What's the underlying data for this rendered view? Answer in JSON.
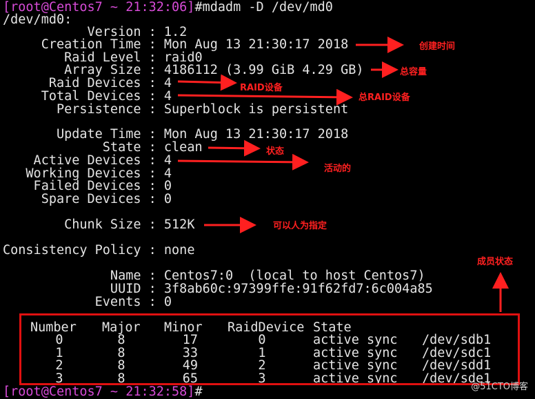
{
  "prompt_top": {
    "user": "[root@Centos7 ~ 21:32:06]",
    "cmd": "#mdadm -D /dev/md0"
  },
  "device": "/dev/md0:",
  "details": [
    {
      "key": "Version",
      "val": "1.2"
    },
    {
      "key": "Creation Time",
      "val": "Mon Aug 13 21:30:17 2018"
    },
    {
      "key": "Raid Level",
      "val": "raid0"
    },
    {
      "key": "Array Size",
      "val": "4186112 (3.99 GiB 4.29 GB)"
    },
    {
      "key": "Raid Devices",
      "val": "4"
    },
    {
      "key": "Total Devices",
      "val": "4"
    },
    {
      "key": "Persistence",
      "val": "Superblock is persistent"
    },
    {
      "key": "Update Time",
      "val": "Mon Aug 13 21:30:17 2018"
    },
    {
      "key": "State",
      "val": "clean"
    },
    {
      "key": "Active Devices",
      "val": "4"
    },
    {
      "key": "Working Devices",
      "val": "4"
    },
    {
      "key": "Failed Devices",
      "val": "0"
    },
    {
      "key": "Spare Devices",
      "val": "0"
    },
    {
      "key": "Chunk Size",
      "val": "512K"
    },
    {
      "key": "Consistency Policy",
      "val": "none"
    },
    {
      "key": "Name",
      "val": "Centos7:0  (local to host Centos7)"
    },
    {
      "key": "UUID",
      "val": "3f8ab60c:97399ffe:91f62fd7:6c004a85"
    },
    {
      "key": "Events",
      "val": "0"
    }
  ],
  "table": {
    "headers": [
      "Number",
      "Major",
      "Minor",
      "RaidDevice",
      "State"
    ],
    "rows": [
      [
        "0",
        "8",
        "17",
        "0",
        "active sync",
        "/dev/sdb1"
      ],
      [
        "1",
        "8",
        "33",
        "1",
        "active sync",
        "/dev/sdc1"
      ],
      [
        "2",
        "8",
        "49",
        "2",
        "active sync",
        "/dev/sdd1"
      ],
      [
        "3",
        "8",
        "65",
        "3",
        "active sync",
        "/dev/sde1"
      ]
    ]
  },
  "prompt_bottom": {
    "user": "[root@Centos7 ~ 21:32:58]",
    "cmd": "#"
  },
  "annotations": {
    "creation_time": "创建时间",
    "array_size": "总容量",
    "raid_devices": "RAID设备",
    "total_devices": "总RAID设备",
    "state": "状态",
    "active": "活动的",
    "chunk": "可以人为指定",
    "members": "成员状态"
  },
  "watermark": "@51CTO博客",
  "colors": {
    "background": "#000000",
    "text": "#e4e4e4",
    "prompt": "#d64bd6",
    "annotation": "#ff2020"
  }
}
